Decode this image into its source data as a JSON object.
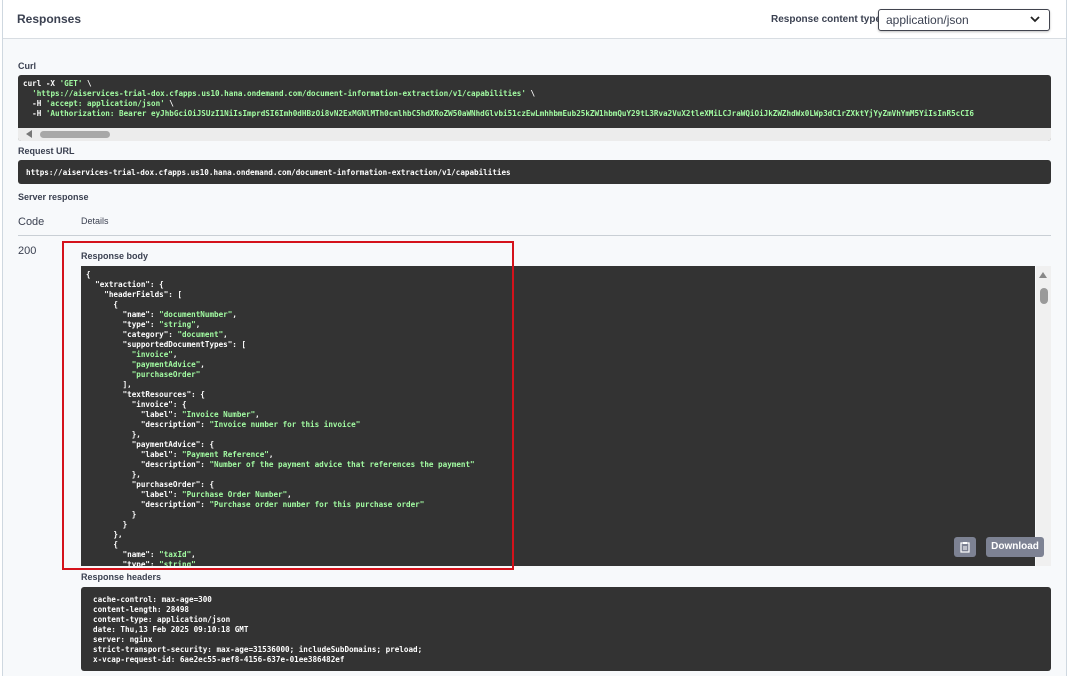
{
  "header": {
    "title": "Responses",
    "content_type_label": "Response content type",
    "content_type_value": "application/json",
    "chevron": "chevron-down-icon"
  },
  "curl": {
    "label": "Curl",
    "line1_a": "curl -X ",
    "line1_method": "'GET'",
    "line1_b": " \\",
    "line2_url": "'https://aiservices-trial-dox.cfapps.us10.hana.ondemand.com/document-information-extraction/v1/capabilities'",
    "line2_b": " \\",
    "line3_a": "  -H ",
    "line3_val": "'accept: application/json'",
    "line3_b": " \\",
    "line4_a": "  -H ",
    "line4_val": "'Authorization: Bearer eyJhbGciOiJSUzI1NiIsImprdSI6Imh0dHBzOi8vN2ExMGNlMTh0cmlhbC5hdXRoZW50aWNhdGlvbi51czEwLmhhbmEub25kZW1hbmQuY29tL3Rva2VuX2tleXMiLCJraWQiOiJkZWZhdWx0LWp3dC1rZXktYjYyZmVhYmM5YiIsInR5cCI6"
  },
  "request_url": {
    "label": "Request URL",
    "value": "https://aiservices-trial-dox.cfapps.us10.hana.ondemand.com/document-information-extraction/v1/capabilities"
  },
  "server_response": {
    "label": "Server response",
    "col_code": "Code",
    "col_details": "Details",
    "code": "200",
    "body_label": "Response body",
    "download_label": "Download",
    "headers_label": "Response headers"
  },
  "response_body_lines": [
    "{",
    "  \"extraction\": {",
    "    \"headerFields\": [",
    "      {",
    "        \"name\": \"documentNumber\",",
    "        \"type\": \"string\",",
    "        \"category\": \"document\",",
    "        \"supportedDocumentTypes\": [",
    "          \"invoice\",",
    "          \"paymentAdvice\",",
    "          \"purchaseOrder\"",
    "        ],",
    "        \"textResources\": {",
    "          \"invoice\": {",
    "            \"label\": \"Invoice Number\",",
    "            \"description\": \"Invoice number for this invoice\"",
    "          },",
    "          \"paymentAdvice\": {",
    "            \"label\": \"Payment Reference\",",
    "            \"description\": \"Number of the payment advice that references the payment\"",
    "          },",
    "          \"purchaseOrder\": {",
    "            \"label\": \"Purchase Order Number\",",
    "            \"description\": \"Purchase order number for this purchase order\"",
    "          }",
    "        }",
    "      },",
    "      {",
    "        \"name\": \"taxId\",",
    "        \"type\": \"string\""
  ],
  "response_headers_lines": [
    "cache-control: max-age=300",
    "content-length: 28498",
    "content-type: application/json",
    "date: Thu,13 Feb 2025 09:10:18 GMT",
    "server: nginx",
    "strict-transport-security: max-age=31536000; includeSubDomains; preload;",
    "x-vcap-request-id: 6ae2ec55-aef8-4156-637e-01ee386482ef"
  ]
}
